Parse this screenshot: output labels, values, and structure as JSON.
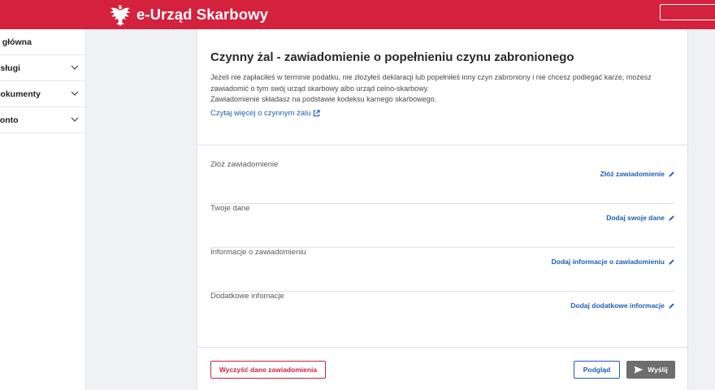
{
  "header": {
    "brand": "e-Urząd Skarbowy",
    "logo_icon": "polish-eagle-icon",
    "colors": {
      "brand_red": "#d4213d"
    }
  },
  "sidebar": {
    "items": [
      {
        "label": "a główna",
        "has_chevron": false
      },
      {
        "label": "usługi",
        "has_chevron": true,
        "icon": "chevron-down-icon"
      },
      {
        "label": "dokumenty",
        "has_chevron": true,
        "icon": "chevron-down-icon"
      },
      {
        "label": "konto",
        "has_chevron": true,
        "icon": "chevron-down-icon"
      }
    ]
  },
  "main": {
    "title": "Czynny żal - zawiadomienie o popełnieniu czynu zabronionego",
    "description_1": "Jeżeli nie zapłaciłeś w terminie podatku, nie złożyłeś deklaracji lub popełniłeś inny czyn zabroniony i nie chcesz podlegać karze, możesz zawiadomić o tym swój urząd skarbowy albo urząd celno-skarbowy.",
    "description_2": "Zawiadomienie składasz na podstawie kodeksu karnego skarbowego.",
    "read_more": "Czytaj więcej o czynnym żalu",
    "read_more_icon": "external-link-icon",
    "sections": [
      {
        "label": "Złóż zawiadomienie",
        "action": "Złóż zawiadomienie",
        "icon": "pencil-icon"
      },
      {
        "label": "Twoje dane",
        "action": "Dodaj swoje dane",
        "icon": "pencil-icon"
      },
      {
        "label": "Informacje o zawiadomieniu",
        "action": "Dodaj informacje o zawiadomieniu",
        "icon": "pencil-icon"
      },
      {
        "label": "Dodatkowe infomacje",
        "action": "Dodaj dodatkowe informacje",
        "icon": "pencil-icon"
      }
    ],
    "buttons": {
      "clear": "Wyczyść dane zawiadomienia",
      "preview": "Podgląd",
      "send": "Wyślij",
      "send_icon": "send-arrow-icon"
    },
    "colors": {
      "link_blue": "#1d5fb4",
      "send_gray": "#6e6e6e"
    }
  }
}
